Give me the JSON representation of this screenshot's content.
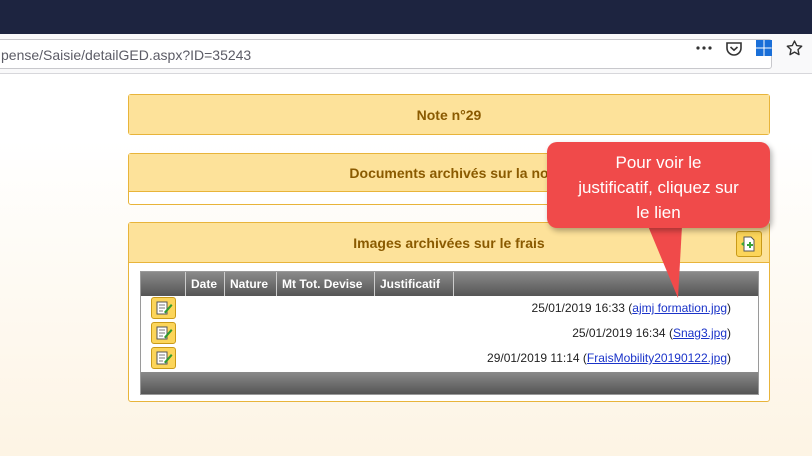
{
  "browser": {
    "url": "pense/Saisie/detailGED.aspx?ID=35243",
    "icons": [
      "more-icon",
      "pocket-icon",
      "windows-icon",
      "star-icon"
    ]
  },
  "note_panel": {
    "title": "Note n°29"
  },
  "docs_panel": {
    "title": "Documents archivés sur la no"
  },
  "images_panel": {
    "title": "Images archivées sur le frais",
    "columns": [
      "",
      "Date",
      "Nature",
      "Mt Tot. Devise",
      "Justificatif",
      ""
    ],
    "rows": [
      {
        "datetime": "25/01/2019 16:33",
        "open": " (",
        "link": "ajmj formation.jpg",
        "close": ")"
      },
      {
        "datetime": "25/01/2019 16:34",
        "open": " (",
        "link": "Snag3.jpg",
        "close": ")"
      },
      {
        "datetime": "29/01/2019 11:14",
        "open": " (",
        "link": "FraisMobility20190122.jpg",
        "close": ")"
      }
    ]
  },
  "callout": {
    "line1": "Pour voir le",
    "line2": "justificatif, cliquez sur",
    "line3": "le lien",
    "color": "#f04a4a"
  }
}
